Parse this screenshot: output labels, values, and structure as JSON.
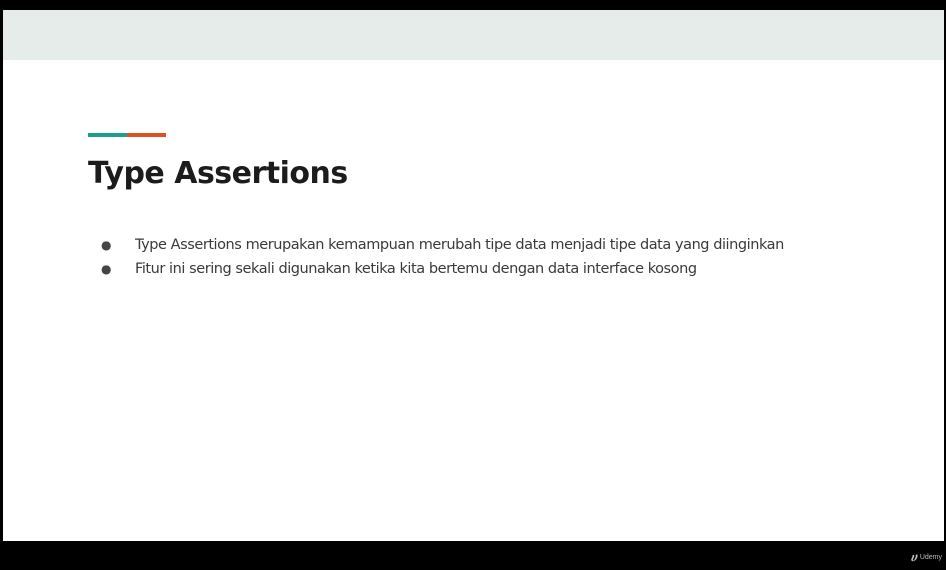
{
  "slide": {
    "title": "Type Assertions",
    "bullets": [
      "Type Assertions merupakan kemampuan merubah tipe data menjadi tipe data yang diinginkan",
      "Fitur ini sering sekali digunakan ketika kita bertemu dengan data interface kosong"
    ],
    "bullet_glyph": "●"
  },
  "watermark": {
    "logo_glyph": "ሀ",
    "label": "Udemy"
  },
  "colors": {
    "accent_teal": "#1e9e8e",
    "accent_orange": "#e0521d",
    "header_band": "#e6ecea",
    "title_text": "#1c1c1c",
    "body_text": "#3a3a3a"
  }
}
